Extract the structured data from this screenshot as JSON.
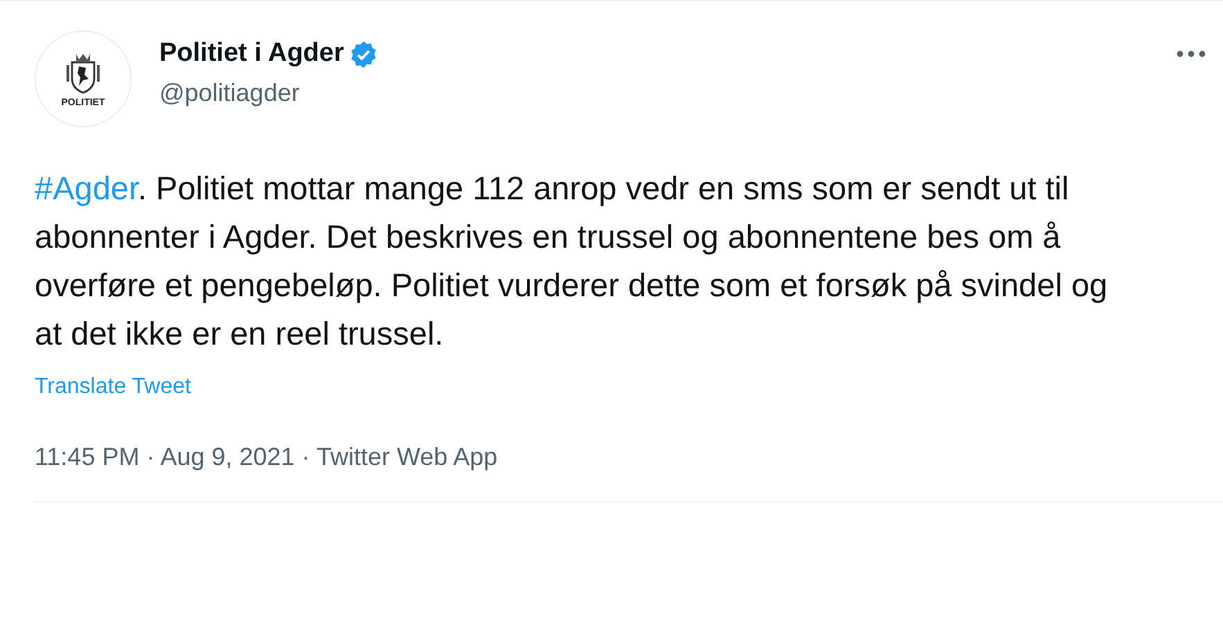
{
  "author": {
    "name": "Politiet i Agder",
    "handle": "@politiagder",
    "verified": true,
    "avatar_text": "POLITIET"
  },
  "tweet": {
    "hashtag": "#Agder",
    "text": ". Politiet mottar mange 112 anrop vedr en sms som er sendt ut til abonnenter i Agder. Det beskrives en trussel og abonnentene bes om å overføre et pengebeløp. Politiet vurderer dette som et forsøk på svindel og at det ikke er en reel trussel."
  },
  "translate": "Translate Tweet",
  "meta": "11:45 PM · Aug 9, 2021 · Twitter Web App"
}
